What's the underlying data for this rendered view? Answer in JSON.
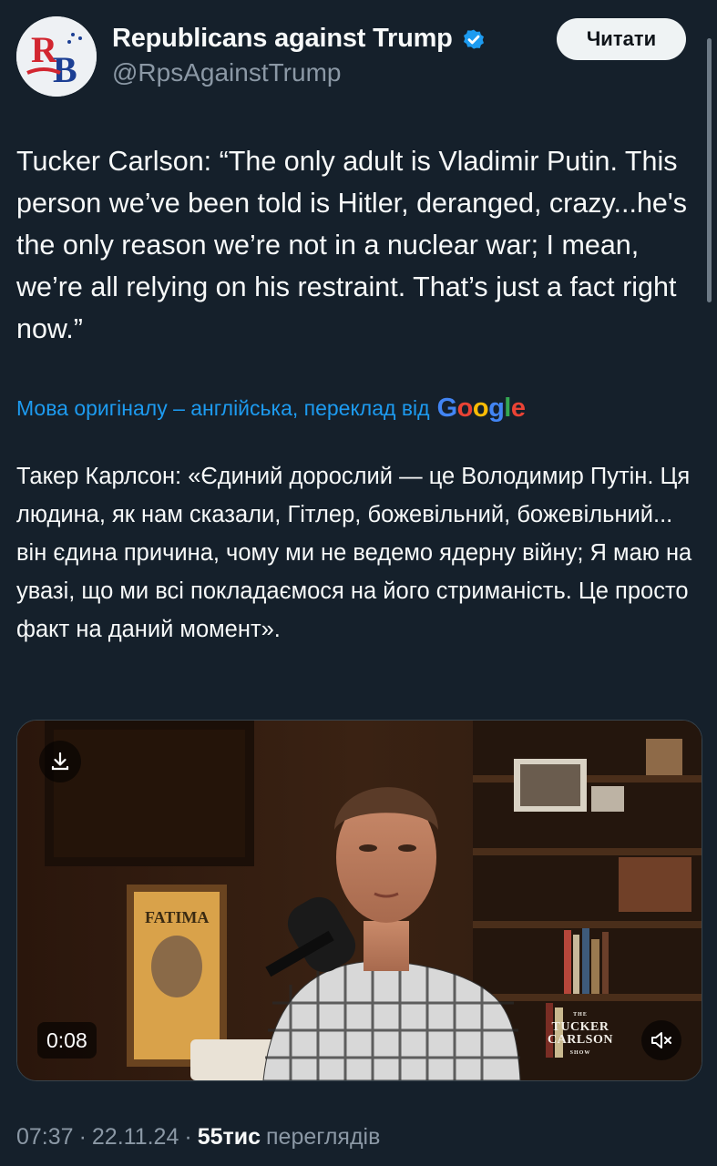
{
  "author": {
    "display_name": "Republicans against Trump",
    "handle": "@RpsAgainstTrump",
    "avatar_letters": "RB",
    "verified_color": "#1d9bf0"
  },
  "follow_button": {
    "label": "Читати"
  },
  "tweet": {
    "text": "Tucker Carlson: “The only adult is Vladimir Putin. This person we’ve been told is Hitler, deranged, crazy...he's the only reason we’re not in a nuclear war; I mean, we’re all relying on his restraint. That’s just a fact right now.”"
  },
  "translation": {
    "note": "Мова оригіналу – англійська, переклад від",
    "provider": "Google",
    "text": "Такер Карлсон: «Єдиний дорослий — це Володимир Путін. Ця людина, як нам сказали, Гітлер, божевільний, божевільний... він єдина причина, чому ми не ведемо ядерну війну; Я маю на увазі, що ми всі покладаємося на його стриманість. Це просто факт на даний момент»."
  },
  "video": {
    "timestamp": "0:08",
    "show_logo_top": "THE",
    "show_logo_line1": "TUCKER",
    "show_logo_line2": "CARLSON",
    "show_logo_bottom": "SHOW",
    "poster_text": "FATIMA",
    "icons": [
      "download-icon",
      "mute-icon"
    ]
  },
  "meta": {
    "time": "07:37",
    "date": "22.11.24",
    "views_count": "55тис",
    "views_label": "переглядів"
  },
  "colors": {
    "background": "#15202b",
    "text": "#f7f9f9",
    "secondary": "#8b98a5",
    "link": "#1d9bf0"
  }
}
